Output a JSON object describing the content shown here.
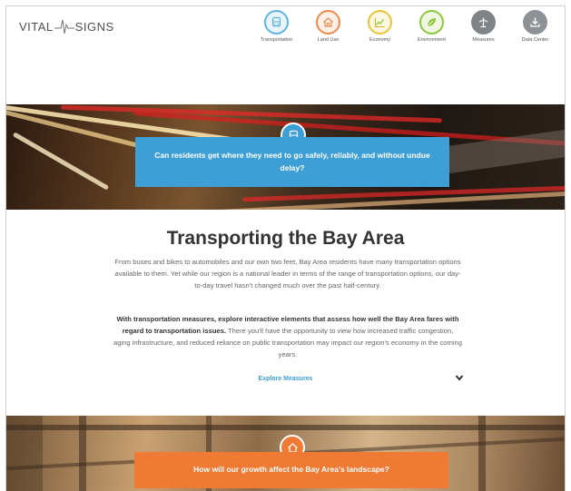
{
  "logo": {
    "left": "VITAL",
    "right": "SIGNS"
  },
  "nav": {
    "items": [
      {
        "label": "Transportation",
        "icon": "bus-icon",
        "color": "#5cb3e0"
      },
      {
        "label": "Land Use",
        "icon": "house-icon",
        "color": "#f08a4b"
      },
      {
        "label": "Economy",
        "icon": "chart-icon",
        "color": "#e7c63a"
      },
      {
        "label": "Environment",
        "icon": "leaf-icon",
        "color": "#8cc63f"
      },
      {
        "label": "Measures",
        "icon": "measures-icon",
        "color": "#7f8489"
      },
      {
        "label": "Data Center",
        "icon": "download-icon",
        "color": "#8d9297"
      }
    ]
  },
  "hero1": {
    "question": "Can residents get where they need to go safely, reliably, and without undue delay?",
    "color": "#3d9fd6"
  },
  "content": {
    "title": "Transporting the Bay Area",
    "paragraph1": "From buses and bikes to automobiles and our own two feet, Bay Area residents have many transportation options available to them. Yet while our region is a national leader in terms of the range of transportation options, our day-to-day travel hasn't changed much over the past half-century.",
    "paragraph2_bold": "With transportation measures, explore interactive elements that assess how well the Bay Area fares with regard to transportation issues.",
    "paragraph2_rest": " There you'll have the opportunity to view how increased traffic congestion, aging infrastructure, and reduced reliance on public transportation may impact our region's economy in the coming years.",
    "explore_link": "Explore Measures"
  },
  "hero2": {
    "question": "How will our growth affect the Bay Area's landscape?",
    "color": "#ee7a33"
  }
}
